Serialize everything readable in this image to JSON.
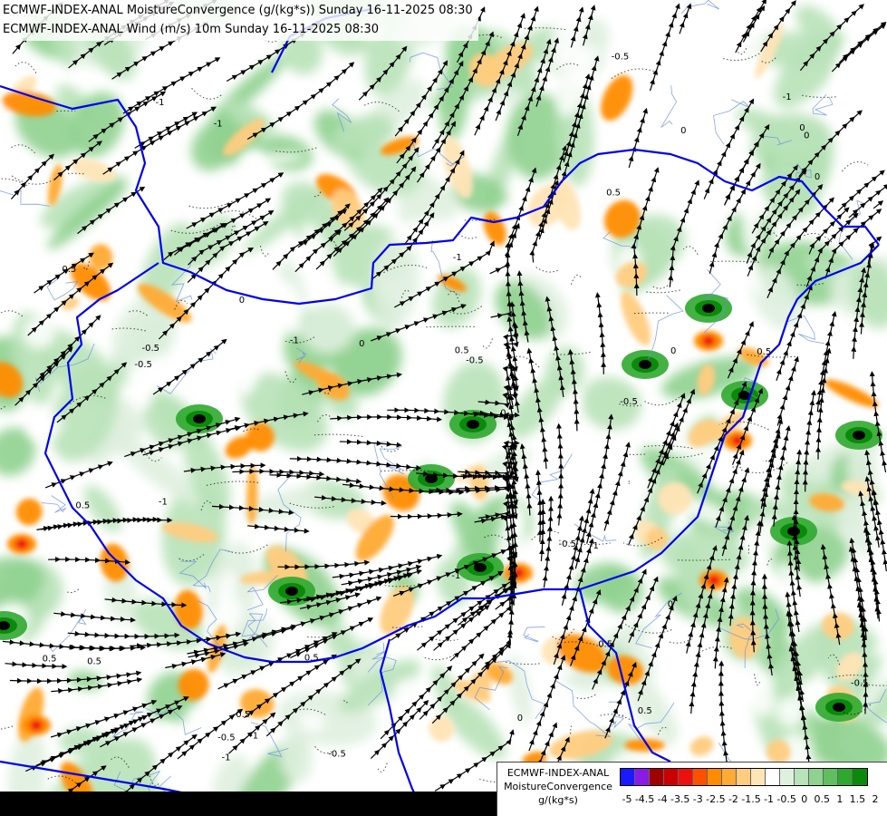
{
  "header": {
    "line1": "ECMWF-INDEX-ANAL MoistureConvergence (g/(kg*s)) Sunday 16-11-2025 08:30",
    "line2": "ECMWF-INDEX-ANAL Wind (m/s) 10m Sunday 16-11-2025 08:30"
  },
  "legend": {
    "model": "ECMWF-INDEX-ANAL",
    "field": "MoistureConvergence",
    "unit": "g/(kg*s)",
    "swatch_colors": [
      "#1a1aff",
      "#8a1ae6",
      "#a00000",
      "#cc0000",
      "#ee1010",
      "#ff5000",
      "#ff8c00",
      "#ffaa33",
      "#ffcc80",
      "#ffe4b5",
      "#ffffff",
      "#dff0df",
      "#b8e2b8",
      "#8fd18f",
      "#5fbf5f",
      "#2fa82f",
      "#0a8a0a"
    ],
    "ticks": [
      "-5",
      "-4.5",
      "-4",
      "-3.5",
      "-3",
      "-2.5",
      "-2",
      "-1.5",
      "-1",
      "-0.5",
      "0",
      "0.5",
      "1",
      "1.5",
      "2"
    ]
  },
  "map_labels": [
    "0",
    "0.5",
    "-0.5",
    "-1"
  ],
  "colors": {
    "border": "#0000ee",
    "river": "#6a8fe0",
    "streamline": "#000000",
    "contour": "#000000"
  }
}
